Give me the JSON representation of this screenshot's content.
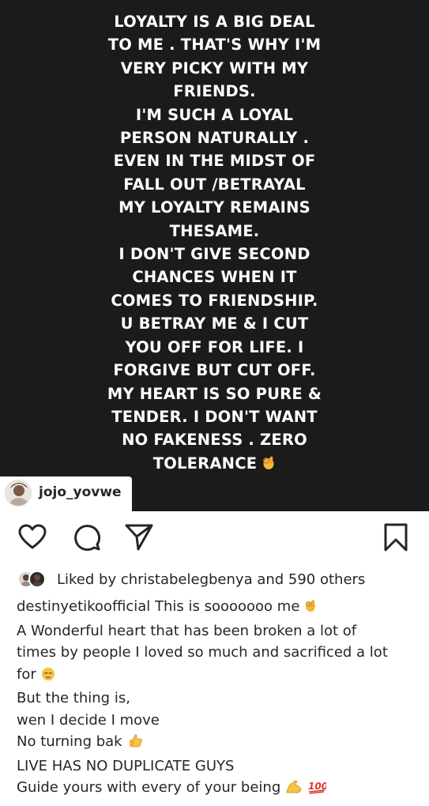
{
  "story": {
    "lines": [
      "LOYALTY IS A BIG DEAL",
      "TO ME . THAT'S WHY I'M",
      "VERY PICKY WITH MY",
      "FRIENDS.",
      "I'M SUCH A LOYAL",
      "PERSON NATURALLY .",
      "EVEN IN THE MIDST OF",
      "FALL OUT /BETRAYAL",
      "MY LOYALTY REMAINS",
      "THESAME.",
      "I DON'T GIVE SECOND",
      "CHANCES WHEN IT",
      "COMES TO FRIENDSHIP.",
      "U BETRAY ME & I CUT",
      "YOU OFF FOR LIFE. I",
      "FORGIVE BUT CUT OFF.",
      "MY HEART IS SO PURE &",
      "TENDER.  I DON'T WANT",
      "NO FAKENESS . ZERO",
      "TOLERANCE"
    ],
    "last_line_emoji": "ok-hand-emoji",
    "background_color": "#1b1b1b"
  },
  "story_user": {
    "username": "jojo_yovwe"
  },
  "actions": {
    "like_icon": "heart-icon",
    "comment_icon": "comment-icon",
    "share_icon": "share-icon",
    "save_icon": "bookmark-icon"
  },
  "likes": {
    "text": "Liked by christabelegbenya and 590 others"
  },
  "caption": {
    "lines": [
      "destinyetikoofficial This is sooooooo me",
      "A Wonderful heart that has been broken a lot of",
      "times by people I loved so much and sacrificed a lot",
      "for",
      "But the thing is,",
      "wen I decide I move",
      "No turning bak",
      "LIVE HAS NO DUPLICATE GUYS",
      "Guide yours with every of your being"
    ],
    "emojis": {
      "line_0": "ok-hand-emoji",
      "line_3": "relieved-face-emoji",
      "line_6": "thumbs-up-emoji",
      "line_8": [
        "flexed-biceps-emoji",
        "hundred-points-emoji"
      ]
    }
  }
}
